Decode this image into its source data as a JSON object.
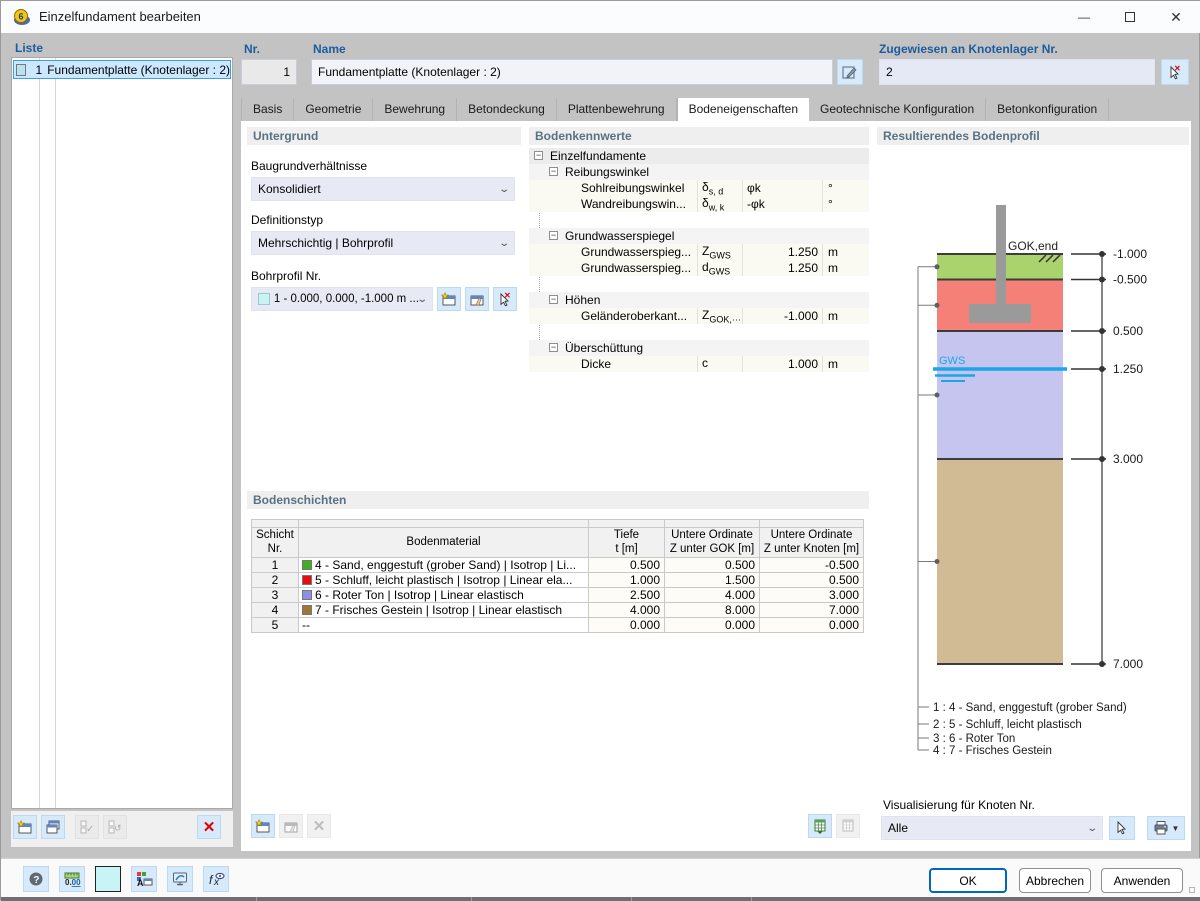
{
  "window": {
    "title": "Einzelfundament bearbeiten"
  },
  "list_panel": {
    "label": "Liste",
    "selected": {
      "nr": "1",
      "name": "Fundamentplatte (Knotenlager : 2)",
      "swatch_color": "#b7e3f2"
    }
  },
  "header": {
    "nr": {
      "label": "Nr.",
      "value": "1"
    },
    "name": {
      "label": "Name",
      "value": "Fundamentplatte (Knotenlager : 2)"
    },
    "assigned": {
      "label": "Zugewiesen an Knotenlager Nr.",
      "value": "2"
    }
  },
  "tabs": {
    "items": [
      "Basis",
      "Geometrie",
      "Bewehrung",
      "Betondeckung",
      "Plattenbewehrung",
      "Bodeneigenschaften",
      "Geotechnische Konfiguration",
      "Betonkonfiguration"
    ],
    "active": "Bodeneigenschaften"
  },
  "untergrund": {
    "header": "Untergrund",
    "baugrund_label": "Baugrundverhältnisse",
    "baugrund_value": "Konsolidiert",
    "definitionstyp_label": "Definitionstyp",
    "definitionstyp_value": "Mehrschichtig | Bohrprofil",
    "bohrprofil_label": "Bohrprofil Nr.",
    "bohrprofil_value": "1 - 0.000, 0.000, -1.000 m ...",
    "bohrprofil_swatch_color": "#c9f4f6"
  },
  "bodenkennwerte": {
    "header": "Bodenkennwerte",
    "root": "Einzelfundamente",
    "g1": {
      "name": "Reibungswinkel",
      "r1": {
        "name": "Sohlreibungswinkel",
        "sym": "δ",
        "sub": "s, d",
        "value": "φk",
        "unit": "°"
      },
      "r2": {
        "name": "Wandreibungswin...",
        "sym": "δ",
        "sub": "w, k",
        "value": "-φk",
        "unit": "°"
      }
    },
    "g2": {
      "name": "Grundwasserspiegel",
      "r1": {
        "name": "Grundwasserspieg...",
        "sym": "Z",
        "sub": "GWS",
        "value": "1.250",
        "unit": "m"
      },
      "r2": {
        "name": "Grundwasserspieg...",
        "sym": "d",
        "sub": "GWS",
        "value": "1.250",
        "unit": "m"
      }
    },
    "g3": {
      "name": "Höhen",
      "r1": {
        "name": "Geländeroberkant...",
        "sym": "Z",
        "sub": "GOK,···",
        "value": "-1.000",
        "unit": "m"
      }
    },
    "g4": {
      "name": "Überschüttung",
      "r1": {
        "name": "Dicke",
        "sym": "c",
        "sub": "",
        "value": "1.000",
        "unit": "m"
      }
    }
  },
  "bodenschichten": {
    "header": "Bodenschichten",
    "col_schicht_1": "Schicht",
    "col_schicht_2": "Nr.",
    "col_material": "Bodenmaterial",
    "col_tiefe_1": "Tiefe",
    "col_tiefe_2": "t [m]",
    "col_gok_1": "Untere Ordinate",
    "col_gok_2": "Z unter GOK [m]",
    "col_knoten_1": "Untere Ordinate",
    "col_knoten_2": "Z unter Knoten [m]",
    "rows": [
      {
        "nr": "1",
        "color": "#3fb01e",
        "material": "4 - Sand, enggestuft (grober Sand) | Isotrop | Li...",
        "tiefe": "0.500",
        "gok": "0.500",
        "knoten": "-0.500"
      },
      {
        "nr": "2",
        "color": "#e60d0d",
        "material": "5 - Schluff, leicht plastisch | Isotrop | Linear ela...",
        "tiefe": "1.000",
        "gok": "1.500",
        "knoten": "0.500"
      },
      {
        "nr": "3",
        "color": "#908ded",
        "material": "6 - Roter Ton | Isotrop | Linear elastisch",
        "tiefe": "2.500",
        "gok": "4.000",
        "knoten": "3.000"
      },
      {
        "nr": "4",
        "color": "#a0753a",
        "material": "7 - Frisches Gestein | Isotrop | Linear elastisch",
        "tiefe": "4.000",
        "gok": "8.000",
        "knoten": "7.000"
      },
      {
        "nr": "5",
        "color": "",
        "material": "--",
        "tiefe": "0.000",
        "gok": "0.000",
        "knoten": "0.000"
      }
    ]
  },
  "profil": {
    "header": "Resultierendes Bodenprofil",
    "gok_label": "GOK,end",
    "gws_label": "GWS",
    "gws_level": "1.250",
    "gws_color": "#1aa7e8",
    "foundation_color": "#9a9a9a",
    "ticks": [
      "-1.000",
      "-0.500",
      "0.500",
      "1.250",
      "3.000",
      "7.000"
    ],
    "layers": [
      {
        "name": "Sand, enggestuft (grober Sand)",
        "color": "#abd36d",
        "from": "-1.000",
        "to": "-0.500"
      },
      {
        "name": "Schluff, leicht plastisch",
        "color": "#f58077",
        "from": "-0.500",
        "to": "0.500"
      },
      {
        "name": "Roter Ton",
        "color": "#c6c5f0",
        "from": "0.500",
        "to": "3.000"
      },
      {
        "name": "Frisches Gestein",
        "color": "#d0bb95",
        "from": "3.000",
        "to": "7.000"
      }
    ],
    "legend": [
      "1 :  4 - Sand, enggestuft (grober Sand)",
      "2 :  5 - Schluff, leicht plastisch",
      "3 :  6 - Roter Ton",
      "4 :  7 - Frisches Gestein"
    ],
    "visualisierung_label": "Visualisierung für Knoten Nr.",
    "visualisierung_value": "Alle"
  },
  "footer": {
    "ok": "OK",
    "cancel": "Abbrechen",
    "apply": "Anwenden"
  }
}
